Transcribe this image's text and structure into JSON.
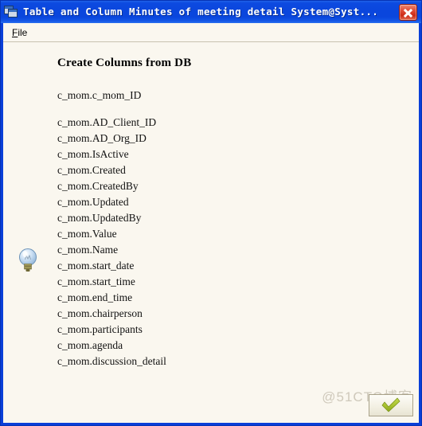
{
  "window": {
    "title": "Table and Column  Minutes of meeting detail  System@Syst...",
    "icon_name": "mdi-windows-icon",
    "close_label": "Close",
    "accent_titlebar": "#0a46dd",
    "accent_close": "#cc2a16",
    "client_bg": "#faf7ef"
  },
  "menubar": {
    "items": [
      {
        "accel": "F",
        "rest": "ile"
      }
    ]
  },
  "content": {
    "hint_icon": "lightbulb-icon",
    "heading": "Create Columns from DB",
    "columns": [
      "c_mom.c_mom_ID",
      "c_mom.AD_Client_ID",
      "c_mom.AD_Org_ID",
      "c_mom.IsActive",
      "c_mom.Created",
      "c_mom.CreatedBy",
      "c_mom.Updated",
      "c_mom.UpdatedBy",
      "c_mom.Value",
      "c_mom.Name",
      "c_mom.start_date",
      "c_mom.start_time",
      "c_mom.end_time",
      "c_mom.chairperson",
      "c_mom.participants",
      "c_mom.agenda",
      "c_mom.discussion_detail"
    ]
  },
  "footer": {
    "ok_icon": "green-check-icon",
    "ok_label": "OK"
  },
  "watermark": {
    "text": "@51CTO博客"
  }
}
